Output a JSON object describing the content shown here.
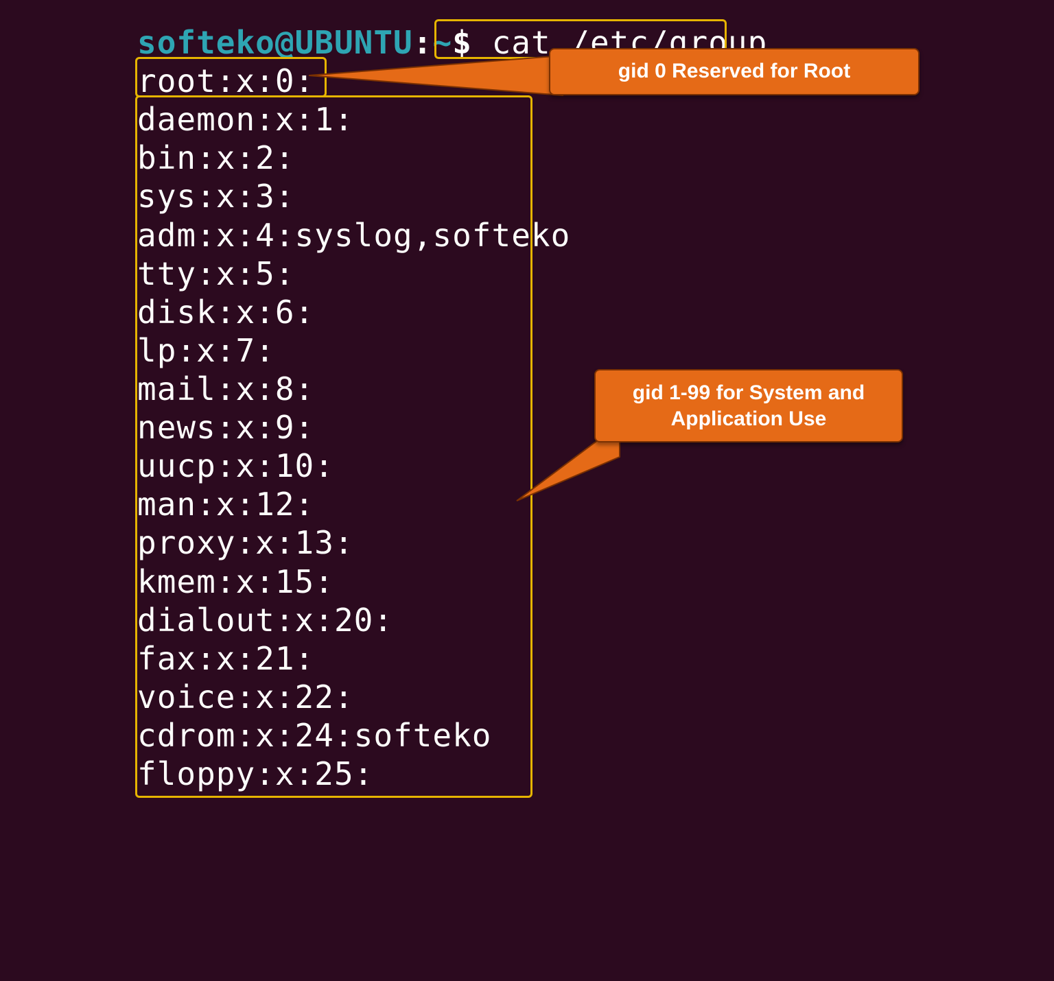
{
  "prompt": {
    "user": "softeko",
    "host": "UBUNTU",
    "path": "~",
    "symbol": "$",
    "command": "cat /etc/group"
  },
  "output": [
    "root:x:0:",
    "daemon:x:1:",
    "bin:x:2:",
    "sys:x:3:",
    "adm:x:4:syslog,softeko",
    "tty:x:5:",
    "disk:x:6:",
    "lp:x:7:",
    "mail:x:8:",
    "news:x:9:",
    "uucp:x:10:",
    "man:x:12:",
    "proxy:x:13:",
    "kmem:x:15:",
    "dialout:x:20:",
    "fax:x:21:",
    "voice:x:22:",
    "cdrom:x:24:softeko",
    "floppy:x:25:"
  ],
  "annotations": {
    "root_callout": "gid 0 Reserved for Root",
    "system_callout": "gid 1-99 for System and Application Use"
  },
  "colors": {
    "bg": "#2c0a1f",
    "text": "#fdfdfb",
    "prompt": "#2ea5b3",
    "highlight_border": "#e6b400",
    "callout_fill": "#e56a17",
    "callout_border": "#7a3102"
  }
}
